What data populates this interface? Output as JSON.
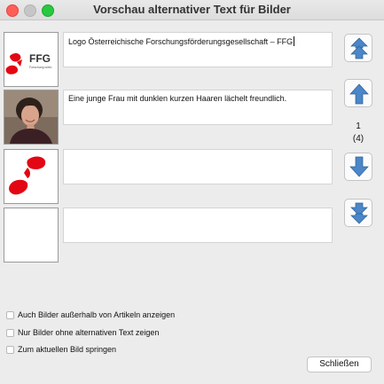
{
  "window": {
    "title": "Vorschau alternativer Text für Bilder"
  },
  "images": [
    {
      "alt_text": "Logo Österreichische Forschungsförderungsgesellschaft – FFG",
      "thumbnail": "ffg-logo",
      "logo_text": "FFG",
      "logo_subtext": "Forschung wirkt."
    },
    {
      "alt_text": "Eine junge Frau mit dunklen kurzen Haaren lächelt freundlich.",
      "thumbnail": "portrait-photo"
    },
    {
      "alt_text": "",
      "thumbnail": "ffg-logo-mark"
    },
    {
      "alt_text": "",
      "thumbnail": "blank"
    }
  ],
  "navigation": {
    "first_icon": "double-arrow-up-icon",
    "prev_icon": "arrow-up-icon",
    "next_icon": "arrow-down-icon",
    "last_icon": "double-arrow-down-icon",
    "current_index": "1",
    "total": "(4)"
  },
  "options": [
    {
      "label": "Auch Bilder außerhalb von Artikeln anzeigen",
      "checked": false
    },
    {
      "label": "Nur Bilder ohne alternativen Text zeigen",
      "checked": false
    },
    {
      "label": "Zum aktuellen Bild springen",
      "checked": false
    }
  ],
  "buttons": {
    "close_label": "Schließen"
  },
  "colors": {
    "arrow_fill": "#4a86c8",
    "logo_red": "#e30613"
  }
}
